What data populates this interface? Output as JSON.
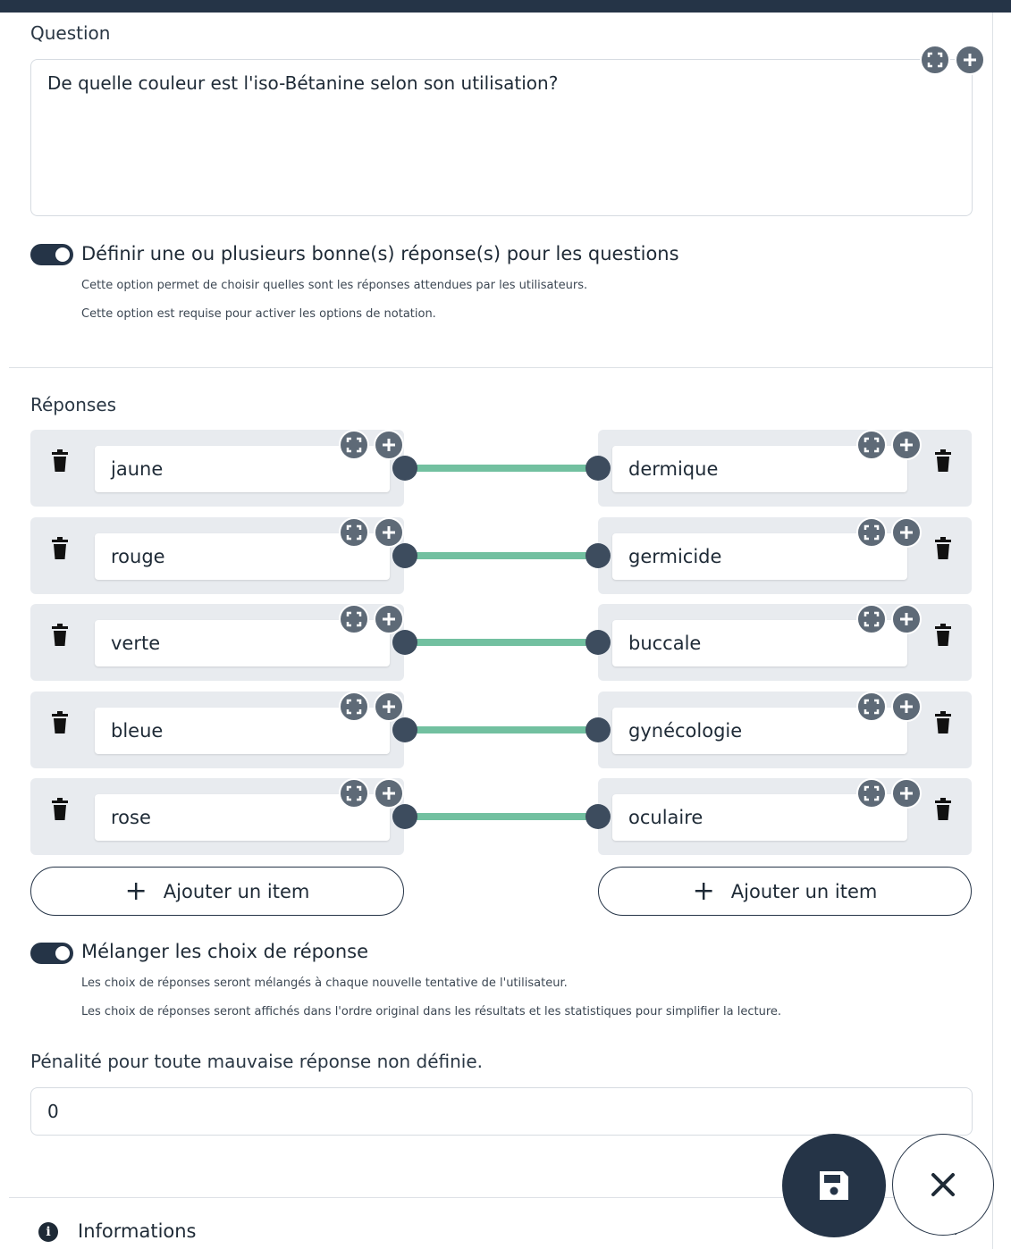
{
  "question": {
    "label": "Question",
    "text": "De quelle couleur est l'iso-Bétanine selon son utilisation?"
  },
  "correct_answers_option": {
    "enabled": true,
    "title": "Définir une ou plusieurs bonne(s) réponse(s) pour les questions",
    "sub1": "Cette option permet de choisir quelles sont les réponses attendues par les utilisateurs.",
    "sub2": "Cette option est requise pour activer les options de notation."
  },
  "responses": {
    "label": "Réponses",
    "pairs": [
      {
        "left": "jaune",
        "right": "dermique"
      },
      {
        "left": "rouge",
        "right": "germicide"
      },
      {
        "left": "verte",
        "right": "buccale"
      },
      {
        "left": "bleue",
        "right": "gynécologie"
      },
      {
        "left": "rose",
        "right": "oculaire"
      }
    ],
    "add_left": "Ajouter un item",
    "add_right": "Ajouter un item"
  },
  "shuffle_option": {
    "enabled": true,
    "title": "Mélanger les choix de réponse",
    "sub1": "Les choix de réponses seront mélangés à chaque nouvelle tentative de l'utilisateur.",
    "sub2": "Les choix de réponses seront affichés dans l'ordre original dans les résultats et les statistiques pour simplifier la lecture."
  },
  "penalty": {
    "label": "Pénalité pour toute mauvaise réponse non définie.",
    "value": "0"
  },
  "footer": {
    "info_label": "Informations"
  },
  "colors": {
    "primary": "#253447",
    "link": "#72c0a0",
    "panel": "#e8ebef"
  }
}
